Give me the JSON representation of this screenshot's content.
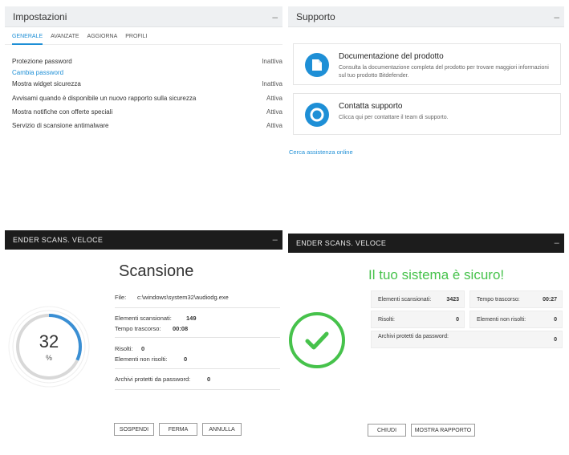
{
  "settings": {
    "title": "Impostazioni",
    "min": "–",
    "tabs": [
      "GENERALE",
      "AVANZATE",
      "AGGIORNA",
      "PROFILI"
    ],
    "rows": [
      {
        "label": "Protezione password",
        "value": "Inattiva"
      },
      {
        "label": "Cambia password",
        "value": ""
      },
      {
        "label": "Mostra widget sicurezza",
        "value": "Inattiva"
      },
      {
        "label": "Avvisami quando è disponibile un nuovo rapporto sulla sicurezza",
        "value": "Attiva"
      },
      {
        "label": "Mostra notifiche con offerte speciali",
        "value": "Attiva"
      },
      {
        "label": "Servizio di scansione antimalware",
        "value": "Attiva"
      }
    ]
  },
  "support": {
    "title": "Supporto",
    "min": "–",
    "cards": [
      {
        "title": "Documentazione del prodotto",
        "desc": "Consulta la documentazione completa del prodotto per trovare maggiori informazioni sul tuo prodotto Bitdefender."
      },
      {
        "title": "Contatta supporto",
        "desc": "Clicca qui per contattare il team di supporto."
      }
    ],
    "link": "Cerca assistenza online"
  },
  "scan": {
    "header": "ENDER SCANS. VELOCE",
    "min": "–",
    "title": "Scansione",
    "progress": 32,
    "progress_text": "32",
    "percent": "%",
    "file_label": "File:",
    "file_value": "c:\\windows\\system32\\audiodg.exe",
    "scanned_label": "Elementi scansionati:",
    "scanned_value": "149",
    "time_label": "Tempo trascorso:",
    "time_value": "00:08",
    "resolved_label": "Risolti:",
    "resolved_value": "0",
    "unresolved_label": "Elementi non risolti:",
    "unresolved_value": "0",
    "archives_label": "Archivi protetti da password:",
    "archives_value": "0",
    "buttons": {
      "pause": "SOSPENDI",
      "stop": "FERMA",
      "cancel": "ANNULLA"
    },
    "accent": "#3a8fd4"
  },
  "result": {
    "header": "ENDER SCANS. VELOCE",
    "min": "–",
    "title": "Il tuo sistema è sicuro!",
    "scanned_label": "Elementi scansionati:",
    "scanned_value": "3423",
    "time_label": "Tempo trascorso:",
    "time_value": "00:27",
    "resolved_label": "Risolti:",
    "resolved_value": "0",
    "unresolved_label": "Elementi non risolti:",
    "unresolved_value": "0",
    "archives_label": "Archivi protetti da password:",
    "archives_value": "0",
    "buttons": {
      "close": "CHIUDI",
      "report": "MOSTRA RAPPORTO"
    },
    "accent": "#46c24b"
  }
}
